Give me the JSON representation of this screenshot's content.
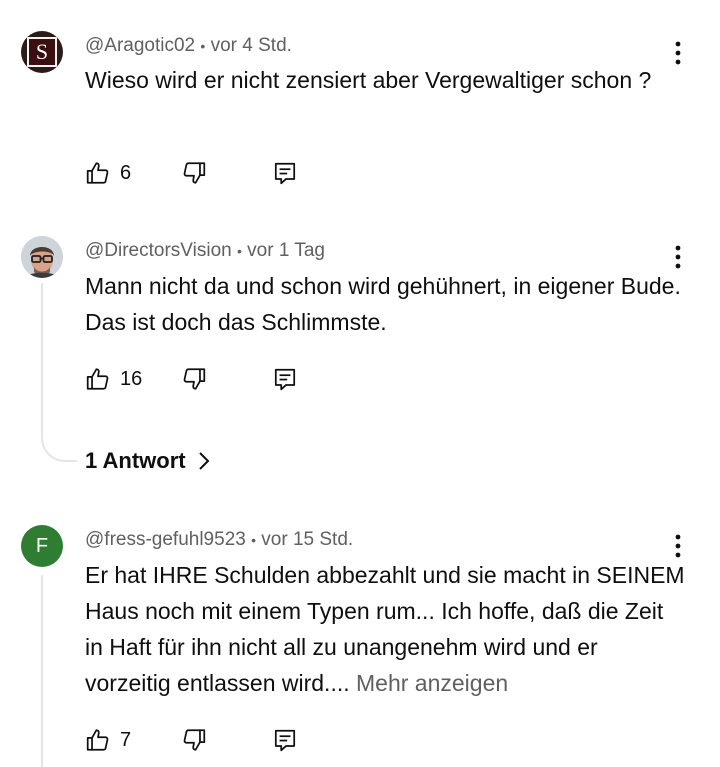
{
  "comments": [
    {
      "author": "@Aragotic02",
      "separator": "•",
      "time": "vor 4 Std.",
      "text": "Wieso wird er nicht zensiert aber Vergewaltiger schon ?",
      "likes": "6",
      "avatar_letter": "S"
    },
    {
      "author": "@DirectorsVision",
      "separator": "•",
      "time": "vor 1 Tag",
      "text": "Mann nicht da und schon wird gehühnert, in eigener Bude. Das ist doch das Schlimmste.",
      "likes": "16",
      "replies_label": "1 Antwort"
    },
    {
      "author": "@fress-gefuhl9523",
      "separator": "•",
      "time": "vor 15 Std.",
      "text": "Er hat IHRE Schulden abbezahlt und sie macht in SEINEM Haus noch mit einem Typen rum... Ich hoffe, daß die Zeit in Haft für ihn nicht all zu unangenehm wird und er vorzeitig entlassen wird....",
      "more": "Mehr anzeigen",
      "likes": "7",
      "avatar_letter": "F"
    }
  ],
  "icons": {
    "like": "thumbs-up-icon",
    "dislike": "thumbs-down-icon",
    "reply": "reply-icon",
    "menu": "more-vert-icon",
    "chevron": "chevron-right-icon"
  },
  "colors": {
    "avatar_f_bg": "#2e7d32",
    "avatar_s_bg": "#2a1a1a",
    "secondary_text": "#606060"
  }
}
